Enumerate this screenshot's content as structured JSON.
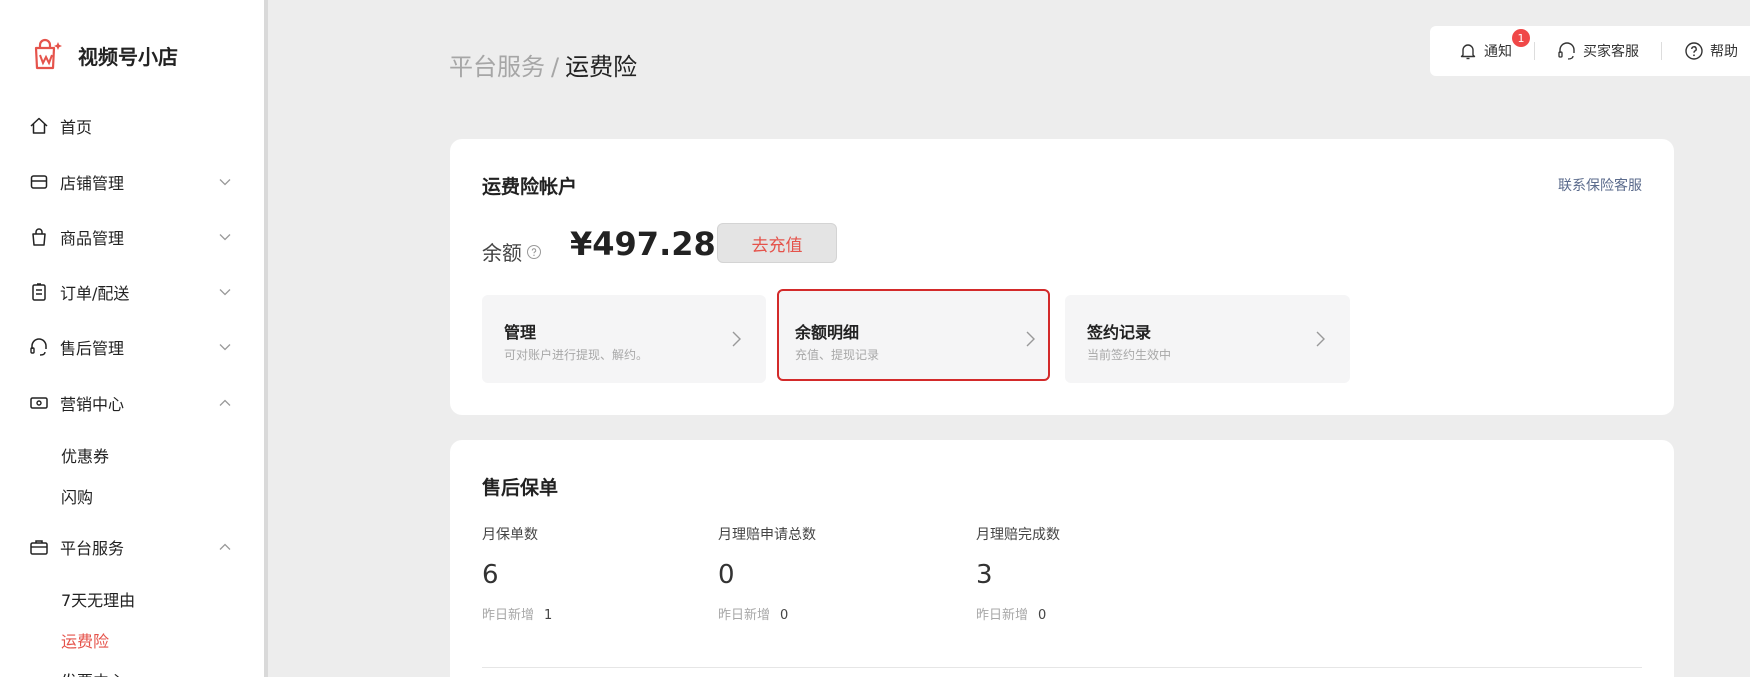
{
  "sidebar": {
    "app_name": "视频号小店",
    "items": [
      {
        "label": "首页",
        "icon": "home-icon"
      },
      {
        "label": "店铺管理",
        "icon": "store-icon",
        "expanded": false
      },
      {
        "label": "商品管理",
        "icon": "bag-icon",
        "expanded": false
      },
      {
        "label": "订单/配送",
        "icon": "clipboard-icon",
        "expanded": false
      },
      {
        "label": "售后管理",
        "icon": "headset-icon",
        "expanded": false
      },
      {
        "label": "营销中心",
        "icon": "ticket-icon",
        "expanded": true
      },
      {
        "label": "平台服务",
        "icon": "briefcase-icon",
        "expanded": true
      }
    ],
    "marketing_sub": [
      "优惠券",
      "闪购"
    ],
    "platform_sub": [
      "7天无理由",
      "运费险",
      "发票中心"
    ],
    "active_sub": "运费险"
  },
  "breadcrumb": {
    "parent": "平台服务",
    "separator": "/",
    "current": "运费险"
  },
  "topbar": {
    "notify_label": "通知",
    "notify_badge": "1",
    "service_label": "买家客服",
    "help_label": "帮助"
  },
  "account_card": {
    "title": "运费险帐户",
    "contact_link": "联系保险客服",
    "balance_label": "余额",
    "balance_value": "¥497.28",
    "recharge_button": "去充值",
    "tiles": [
      {
        "title": "管理",
        "subtitle": "可对账户进行提现、解约。",
        "selected": false
      },
      {
        "title": "余额明细",
        "subtitle": "充值、提现记录",
        "selected": true
      },
      {
        "title": "签约记录",
        "subtitle": "当前签约生效中",
        "selected": false
      }
    ]
  },
  "policy_card": {
    "title": "售后保单",
    "stats": [
      {
        "label": "月保单数",
        "value": "6",
        "inc_label": "昨日新增",
        "inc_value": "1"
      },
      {
        "label": "月理赔申请总数",
        "value": "0",
        "inc_label": "昨日新增",
        "inc_value": "0"
      },
      {
        "label": "月理赔完成数",
        "value": "3",
        "inc_label": "昨日新增",
        "inc_value": "0"
      }
    ]
  },
  "colors": {
    "accent": "#e5534b",
    "selection_border": "#d32a2a",
    "link": "#5b6b8c"
  }
}
